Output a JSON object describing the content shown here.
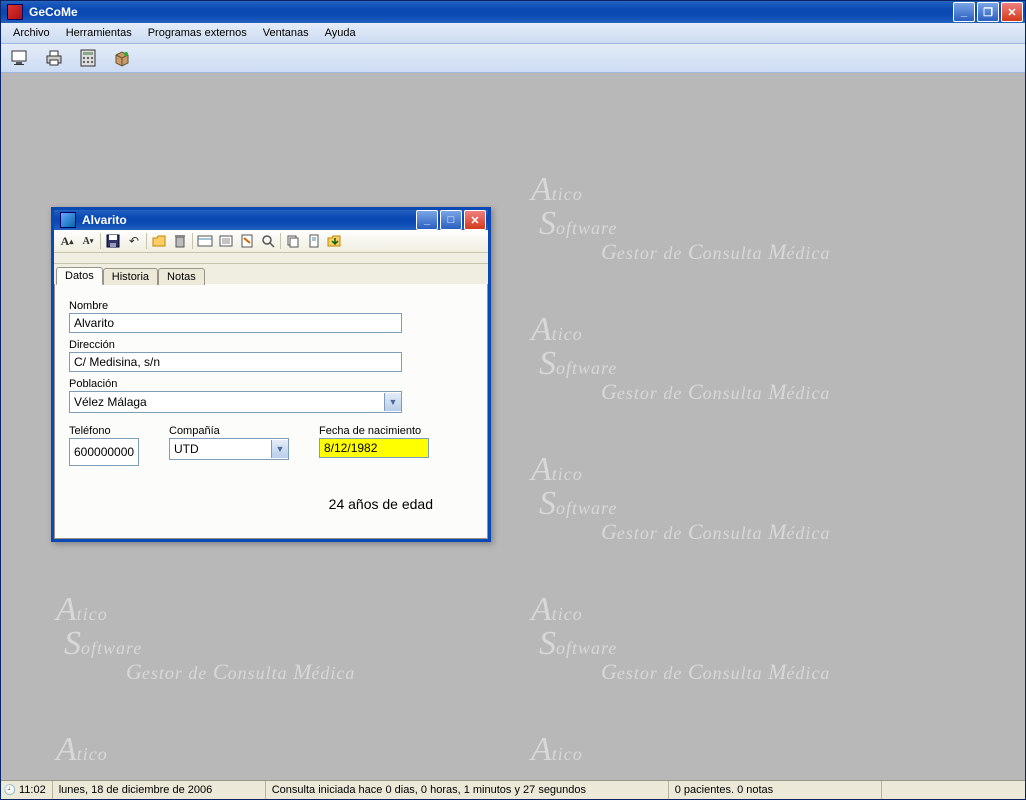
{
  "app": {
    "title": "GeCoMe"
  },
  "menu": {
    "archivo": "Archivo",
    "herramientas": "Herramientas",
    "programas": "Programas externos",
    "ventanas": "Ventanas",
    "ayuda": "Ayuda"
  },
  "child": {
    "title": "Alvarito",
    "tabs": {
      "datos": "Datos",
      "historia": "Historia",
      "notas": "Notas"
    },
    "labels": {
      "nombre": "Nombre",
      "direccion": "Dirección",
      "poblacion": "Población",
      "telefono": "Teléfono",
      "compania": "Compañía",
      "fecha": "Fecha de nacimiento"
    },
    "fields": {
      "nombre": "Alvarito",
      "direccion": "C/ Medisina, s/n",
      "poblacion": "Vélez Málaga",
      "telefono": "600000000",
      "compania": "UTD",
      "fecha": "8/12/1982"
    },
    "age": "24 años de edad"
  },
  "status": {
    "time": "11:02",
    "date": "lunes, 18 de diciembre de 2006",
    "session": "Consulta iniciada hace 0 dias, 0 horas, 1 minutos y 27 segundos",
    "counts": "0 pacientes. 0 notas"
  },
  "watermark": {
    "line1a": "A",
    "line1b": "tico",
    "line2a": "S",
    "line2b": "oftware",
    "line3a": "G",
    "line3b": "estor de ",
    "line3c": "C",
    "line3d": "onsulta ",
    "line3e": "M",
    "line3f": "édica"
  }
}
